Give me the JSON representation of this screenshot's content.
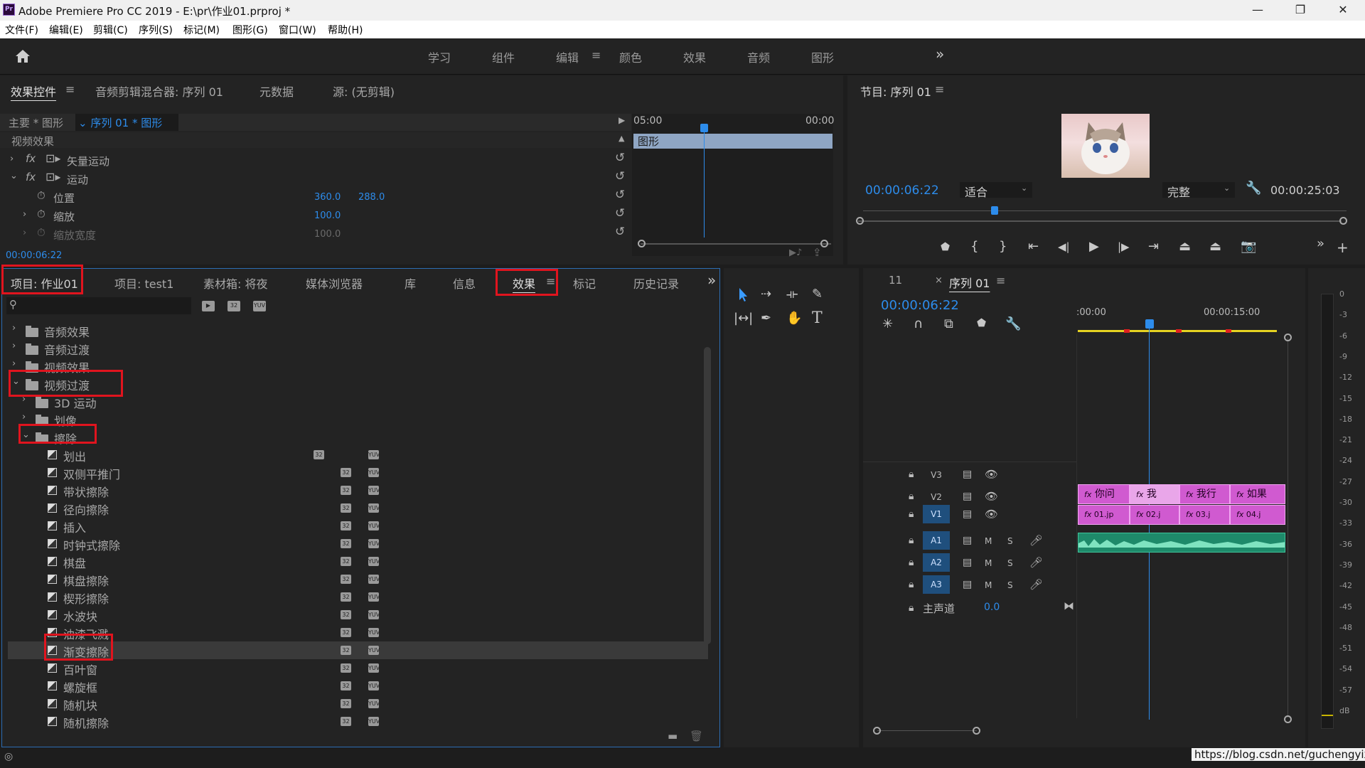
{
  "window": {
    "title": "Adobe Premiere Pro CC 2019 - E:\\pr\\作业01.prproj *",
    "logo": "Pr",
    "minimize": "—",
    "restore": "❐",
    "close": "✕"
  },
  "menu": [
    "文件(F)",
    "编辑(E)",
    "剪辑(C)",
    "序列(S)",
    "标记(M)",
    "图形(G)",
    "窗口(W)",
    "帮助(H)"
  ],
  "workspaces": {
    "items": [
      "学习",
      "组件",
      "编辑",
      "颜色",
      "效果",
      "音频",
      "图形"
    ],
    "active": "编辑",
    "more": "»"
  },
  "effect_controls": {
    "tabs": [
      "效果控件",
      "音频剪辑混合器: 序列 01",
      "元数据",
      "源: (无剪辑)"
    ],
    "menu_icon": "≡",
    "master": "主要 * 图形",
    "sequence": "序列 01 * 图形",
    "video_effects": "视频效果",
    "vector_motion": "矢量运动",
    "motion": "运动",
    "position_label": "位置",
    "position_x": "360.0",
    "position_y": "288.0",
    "scale_label": "缩放",
    "scale_value": "100.0",
    "scale_width_label": "缩放宽度",
    "scale_width_value": "100.0",
    "time_start": "05:00",
    "time_end": "00:00",
    "clip_label": "图形",
    "timecode": "00:00:06:22"
  },
  "program": {
    "title": "节目: 序列 01",
    "timecode": "00:00:06:22",
    "fit": "适合",
    "quality": "完整",
    "duration": "00:00:25:03"
  },
  "project_panel": {
    "tabs": [
      "项目: 作业01",
      "项目: test1",
      "素材箱: 将夜",
      "媒体浏览器",
      "库",
      "信息",
      "效果",
      "标记",
      "历史记录"
    ],
    "active_tab": "效果",
    "more": "»"
  },
  "effects_tree": {
    "folders": [
      "音频效果",
      "音频过渡",
      "视频效果",
      "视频过渡"
    ],
    "sub": [
      "3D 运动",
      "划像",
      "擦除"
    ],
    "items": [
      "划出",
      "双侧平推门",
      "带状擦除",
      "径向擦除",
      "插入",
      "时钟式擦除",
      "棋盘",
      "棋盘擦除",
      "楔形擦除",
      "水波块",
      "油漆飞溅",
      "渐变擦除",
      "百叶窗",
      "螺旋框",
      "随机块",
      "随机擦除"
    ],
    "selected": "渐变擦除",
    "icon_a": "32",
    "icon_b": "YUV"
  },
  "timeline": {
    "tab_prev": "11",
    "tab_close": "×",
    "tab": "序列 01",
    "timecode": "00:00:06:22",
    "ruler_start": ":00:00",
    "ruler_mid": "00:00:15:00",
    "tracks": [
      "V3",
      "V2",
      "V1",
      "A1",
      "A2",
      "A3"
    ],
    "master": "主声道",
    "master_value": "0.0",
    "v2_clips": [
      "你问",
      "我",
      "我行",
      "如果"
    ],
    "v1_clips": [
      "01.jp",
      "02.j",
      "03.j",
      "04.j"
    ],
    "m": "M",
    "s": "S"
  },
  "meter": {
    "ticks": [
      "0",
      "-3",
      "-6",
      "-9",
      "-12",
      "-15",
      "-18",
      "-21",
      "-24",
      "-27",
      "-30",
      "-33",
      "-36",
      "-39",
      "-42",
      "-45",
      "-48",
      "-51",
      "-54",
      "-57",
      "dB"
    ]
  },
  "watermark": "https://blog.csdn.net/guchengyixin"
}
